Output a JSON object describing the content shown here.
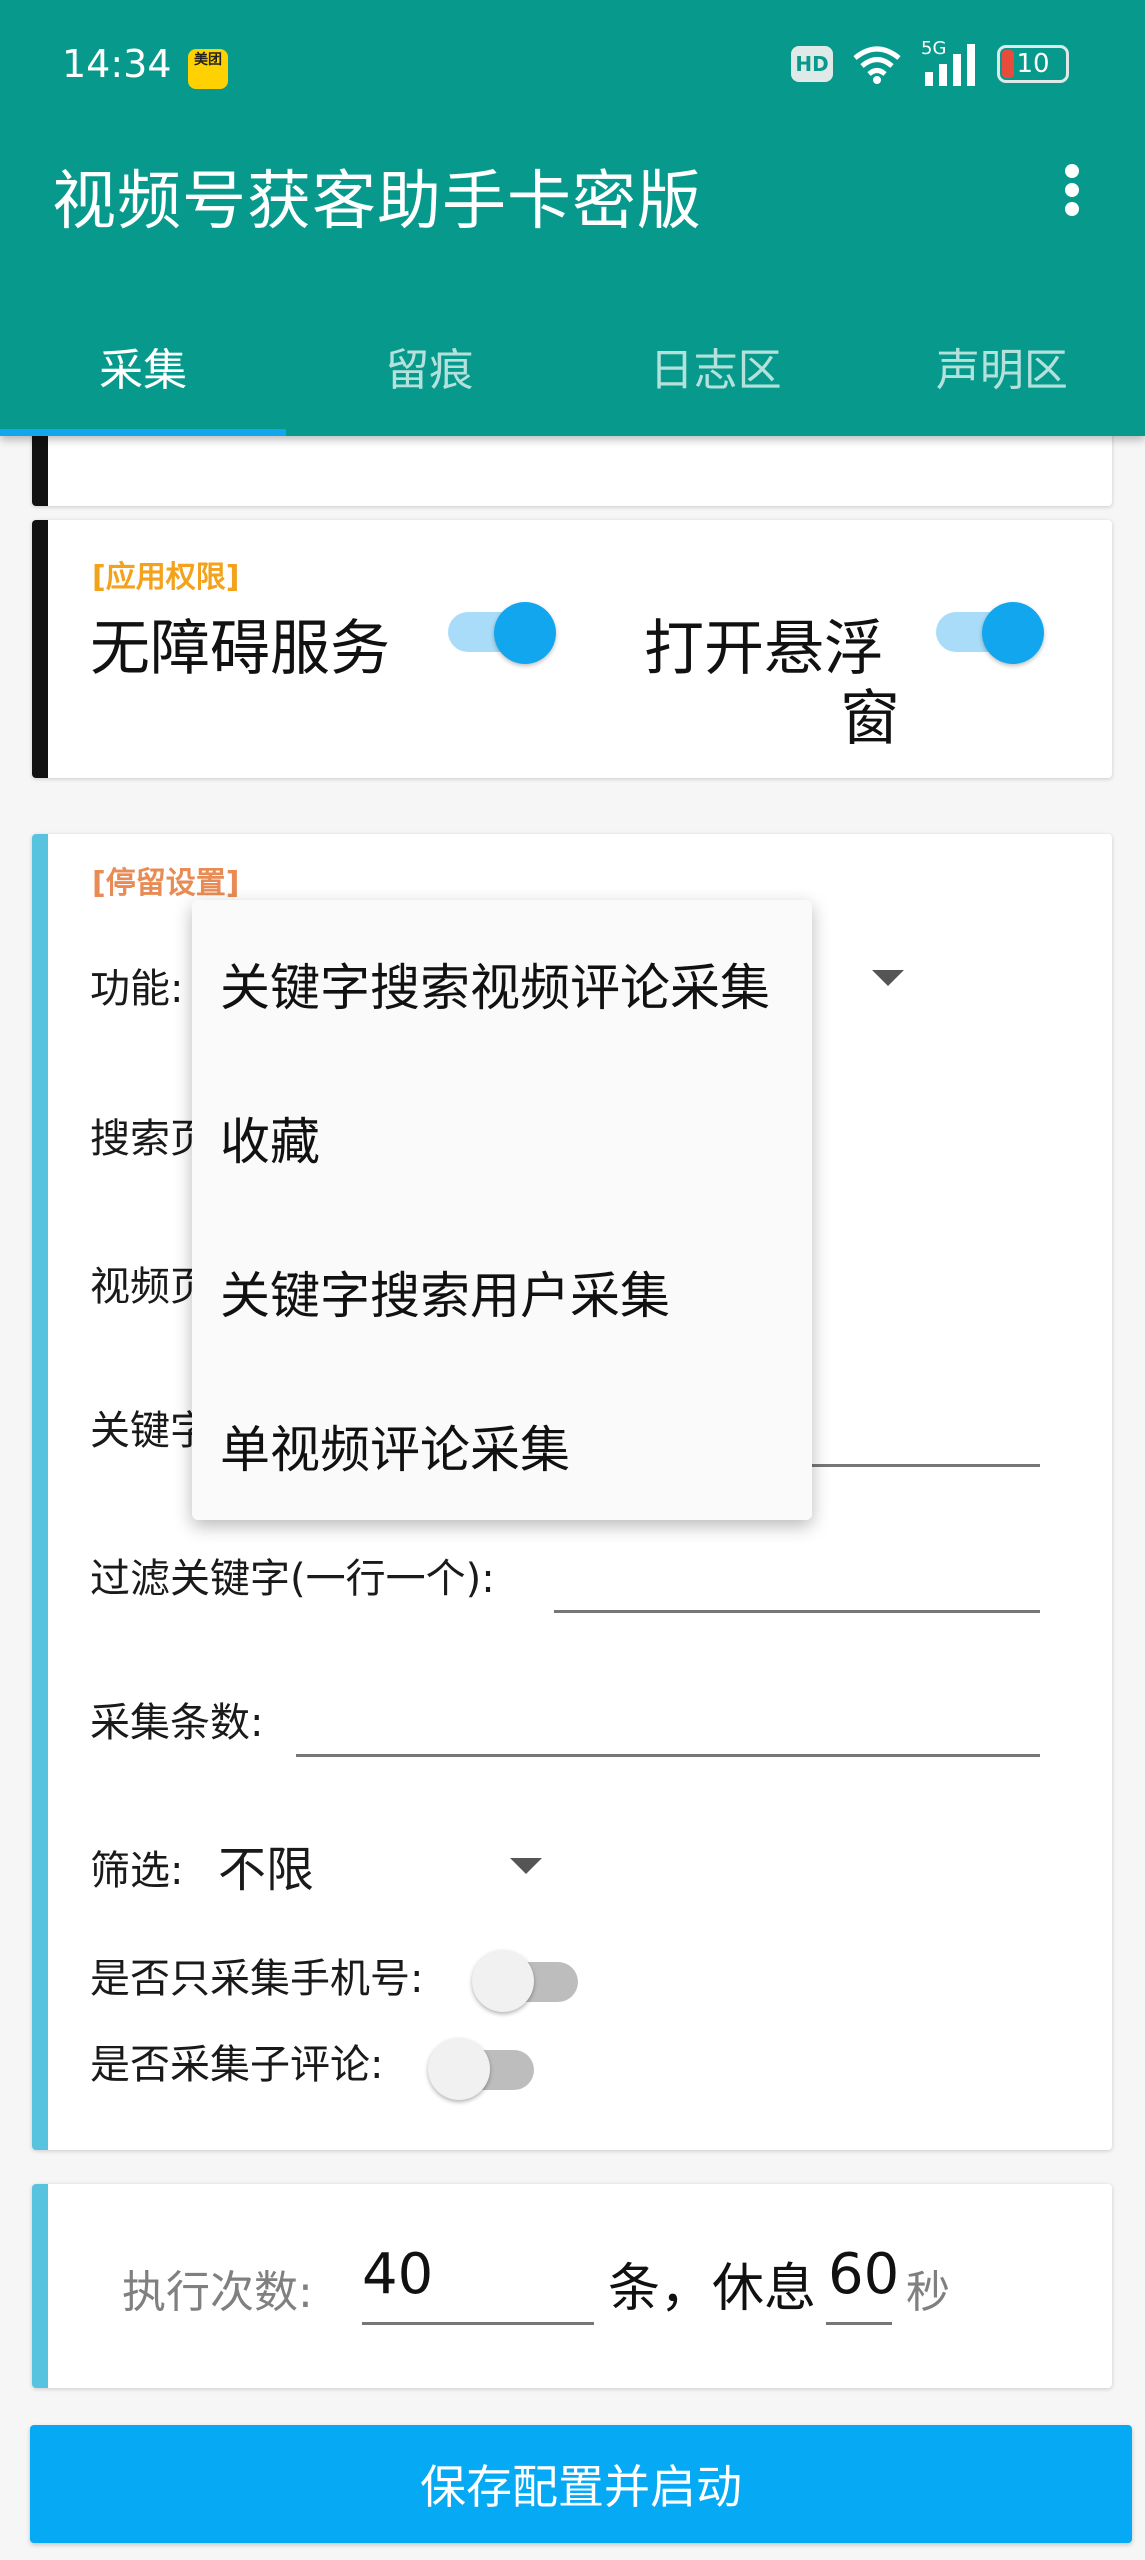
{
  "status_bar": {
    "time": "14:34",
    "meituan_label": "美团",
    "hd": "HD",
    "network": "5G",
    "battery": "10"
  },
  "app": {
    "title": "视频号获客助手卡密版"
  },
  "tabs": [
    {
      "label": "采集"
    },
    {
      "label": "留痕"
    },
    {
      "label": "日志区"
    },
    {
      "label": "声明区"
    }
  ],
  "permissions": {
    "tag": "[应用权限]",
    "accessibility_label": "无障碍服务",
    "accessibility_on": true,
    "floating_label_line1": "打开悬浮",
    "floating_label_line2": "窗",
    "floating_on": true
  },
  "settings": {
    "tag": "[停留设置]",
    "function_label": "功能:",
    "search_page_label": "搜索页",
    "video_page_label": "视频页",
    "keyword_label": "关键字",
    "filter_keyword_label": "过滤关键字(一行一个):",
    "collect_count_label": "采集条数:",
    "filter_label": "筛选:",
    "filter_value": "不限",
    "phone_only_label": "是否只采集手机号:",
    "phone_only_on": false,
    "sub_comment_label": "是否采集子评论:",
    "sub_comment_on": false
  },
  "function_menu": {
    "options": [
      "关键字搜索视频评论采集",
      "收藏",
      "关键字搜索用户采集",
      "单视频评论采集"
    ]
  },
  "execution": {
    "count_label": "执行次数:",
    "count_value": "40",
    "unit_text": "条，休息",
    "rest_value": "60",
    "rest_unit": "秒"
  },
  "actions": {
    "save_start": "保存配置并启动"
  }
}
